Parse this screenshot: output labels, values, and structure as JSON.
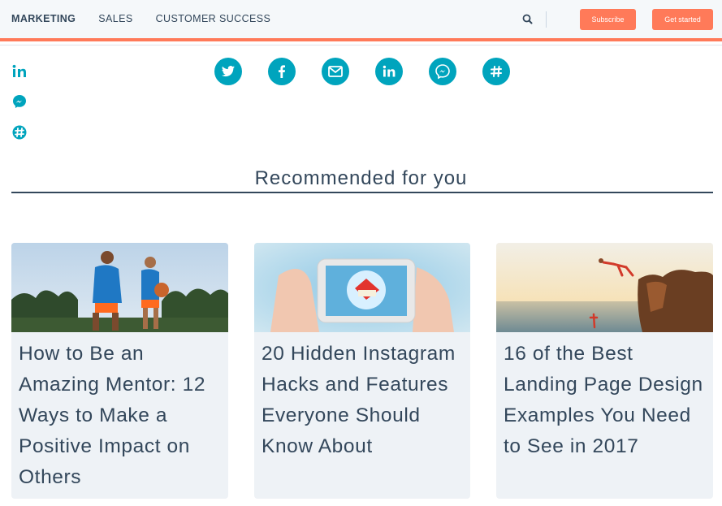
{
  "nav": {
    "links": [
      "MARKETING",
      "SALES",
      "CUSTOMER SUCCESS"
    ],
    "subscribe_label": "Subscribe",
    "get_started_label": "Get started"
  },
  "left_share": [
    "linkedin-icon",
    "messenger-icon",
    "slack-icon"
  ],
  "share_bar": [
    "twitter-icon",
    "facebook-icon",
    "email-icon",
    "linkedin-icon",
    "messenger-icon",
    "slack-icon"
  ],
  "recommended": {
    "heading": "Recommended for you",
    "cards": [
      {
        "title": "How to Be an Amazing Mentor: 12 Ways to Make a Positive Impact on Others"
      },
      {
        "title": "20 Hidden Instagram Hacks and Features Everyone Should Know About"
      },
      {
        "title": "16 of the Best Landing Page Design Examples You Need to See in 2017"
      }
    ]
  },
  "colors": {
    "accent": "#ff7a59",
    "share_teal": "#00a4bd",
    "text": "#33475b",
    "card_bg": "#eef2f6"
  }
}
